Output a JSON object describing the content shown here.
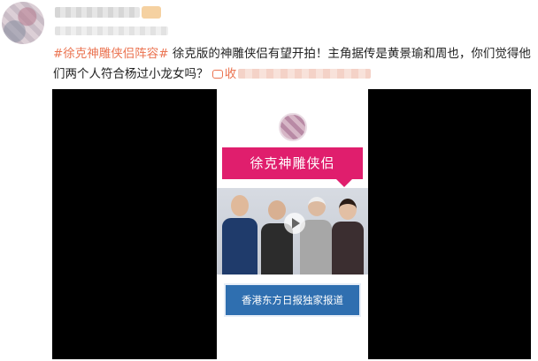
{
  "post": {
    "hashtag": "#徐克神雕侠侣阵容#",
    "text": " 徐克版的神雕侠侣有望开拍！主角据传是黄景瑜和周也，你们觉得他们两个人符合杨过小龙女吗？",
    "link_label": "收"
  },
  "video": {
    "title_banner": "徐克神雕侠侣",
    "source_banner": "香港东方日报独家报道"
  }
}
